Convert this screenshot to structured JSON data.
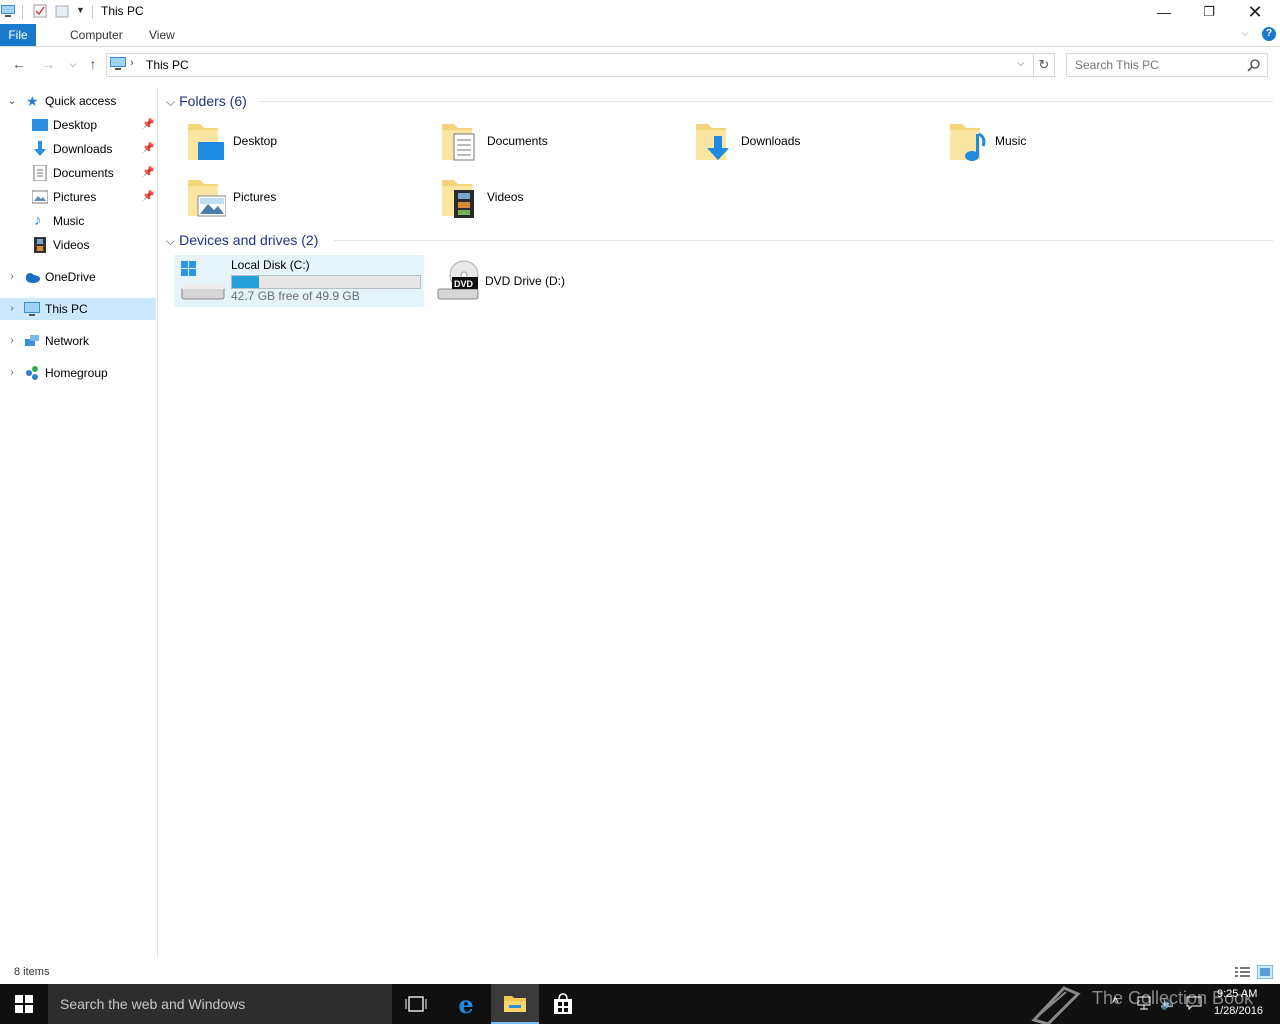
{
  "window": {
    "title": "This PC"
  },
  "ribbon": {
    "tabs": [
      "File",
      "Computer",
      "View"
    ]
  },
  "address": {
    "crumb": "This PC",
    "search_placeholder": "Search This PC"
  },
  "navpane": {
    "quick_access": "Quick access",
    "pinned": [
      "Desktop",
      "Downloads",
      "Documents",
      "Pictures"
    ],
    "unpinned": [
      "Music",
      "Videos"
    ],
    "roots": [
      "OneDrive",
      "This PC",
      "Network",
      "Homegroup"
    ]
  },
  "folders": {
    "header": "Folders (6)",
    "items": [
      "Desktop",
      "Documents",
      "Downloads",
      "Music",
      "Pictures",
      "Videos"
    ]
  },
  "drives": {
    "header": "Devices and drives (2)",
    "local": {
      "name": "Local Disk (C:)",
      "free_text": "42.7 GB free of 49.9 GB",
      "used_fraction": 0.144
    },
    "dvd": {
      "name": "DVD Drive (D:)",
      "badge": "DVD"
    }
  },
  "status": {
    "items": "8 items"
  },
  "taskbar": {
    "search_placeholder": "Search the web and Windows",
    "time": "9:25 AM",
    "date": "1/28/2016",
    "watermark": "The Collection Book"
  },
  "colors": {
    "accent": "#1979ca",
    "selected": "#cce8ff",
    "taskbar": "#101010",
    "group_header": "#1e3287"
  }
}
